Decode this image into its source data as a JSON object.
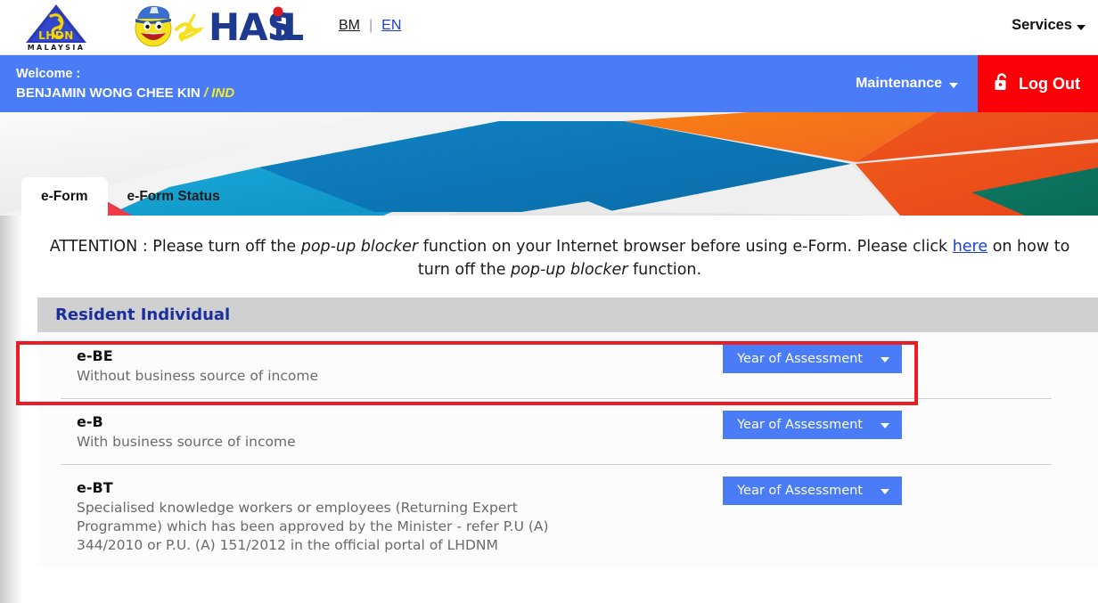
{
  "header": {
    "lhdn_logo": {
      "name": "lhdn-logo",
      "text": "LHDN",
      "subtext": "MALAYSIA"
    },
    "ezhasil_logo": {
      "name": "ezhasil-logo",
      "ez": "ez",
      "hasil": "HASiL"
    },
    "language": {
      "bm": "BM",
      "en": "EN",
      "separator": "|"
    },
    "services_label": "Services"
  },
  "welcome": {
    "greeting": "Welcome :",
    "user_name": "BENJAMIN WONG CHEE KIN",
    "user_type": "/ IND",
    "maintenance_label": "Maintenance",
    "logout_label": "Log Out"
  },
  "tabs": [
    {
      "label": "e-Form",
      "active": true
    },
    {
      "label": "e-Form Status",
      "active": false
    }
  ],
  "attention": {
    "prefix": "ATTENTION : Please turn off the ",
    "em1": "pop-up blocker",
    "mid": " function on your Internet browser before using e-Form. Please click ",
    "link": "here",
    "mid2": " on how to turn off the ",
    "em2": "pop-up blocker",
    "suffix": " function."
  },
  "section": {
    "title": "Resident Individual"
  },
  "forms": [
    {
      "code": "e-BE",
      "description": "Without business source of income",
      "button_label": "Year of Assessment",
      "highlighted": true
    },
    {
      "code": "e-B",
      "description": "With business source of income",
      "button_label": "Year of Assessment",
      "highlighted": false
    },
    {
      "code": "e-BT",
      "description": "Specialised knowledge workers or employees (Returning Expert Programme) which has been approved by the Minister - refer P.U (A) 344/2010 or P.U. (A) 151/2012 in the official portal of LHDNM",
      "button_label": "Year of Assessment",
      "highlighted": false
    }
  ],
  "colors": {
    "brand_blue": "#4a7cf7",
    "logout_red": "#fb0007",
    "section_heading": "#1a2f9e",
    "highlight_red": "#ec1c24",
    "link_blue": "#1a41d8"
  }
}
